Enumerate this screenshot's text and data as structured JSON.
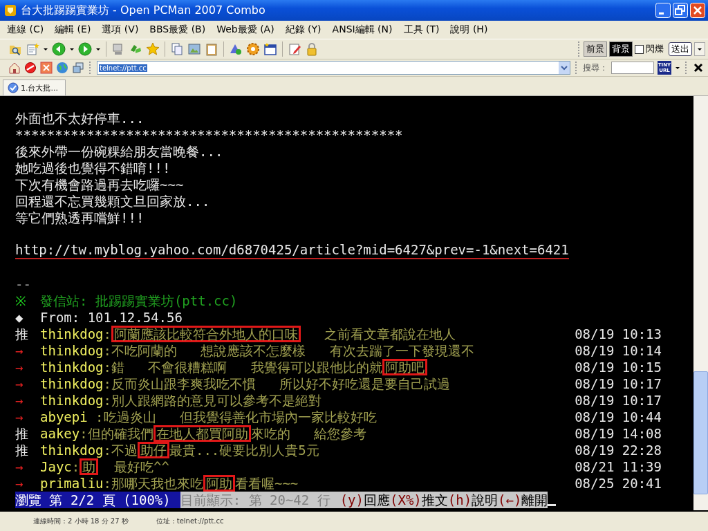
{
  "window": {
    "title": "台大批踢踢實業坊 - Open PCMan 2007 Combo"
  },
  "menu": [
    "連線 (C)",
    "編輯 (E)",
    "選項 (V)",
    "BBS最愛 (B)",
    "Web最愛 (A)",
    "紀錄 (Y)",
    "ANSI編輯 (N)",
    "工具 (T)",
    "說明 (H)"
  ],
  "toolbar": {
    "color_buttons": [
      {
        "label": "前景",
        "selected": false
      },
      {
        "label": "背景",
        "selected": true
      }
    ],
    "blink": {
      "label": "閃爍",
      "checked": false
    },
    "send": "送出"
  },
  "address_bar": {
    "value": "telnet://ptt.cc",
    "search_label": "搜尋：",
    "tinyurl": [
      "TINY",
      "URL"
    ]
  },
  "tabs": [
    {
      "label": "1.台大批...",
      "selected": true
    }
  ],
  "terminal": {
    "lines": [
      {
        "kind": "text",
        "text": "外面也不太好停車..."
      },
      {
        "kind": "text",
        "text": "*************************************************"
      },
      {
        "kind": "text",
        "text": "後來外帶一份碗粿給朋友當晚餐..."
      },
      {
        "kind": "text",
        "text": "她吃過後也覺得不錯唷!!!"
      },
      {
        "kind": "text",
        "text": "下次有機會路過再去吃囉~~~"
      },
      {
        "kind": "text",
        "text": "回程還不忘買幾顆文旦回家放..."
      },
      {
        "kind": "text",
        "text": "等它們熟透再嚐鮮!!!"
      },
      {
        "kind": "blank"
      },
      {
        "kind": "link",
        "text": "http://tw.myblog.yahoo.com/d6870425/article?mid=6427&prev=-1&next=6421"
      },
      {
        "kind": "blank"
      },
      {
        "kind": "signature",
        "text": "--"
      },
      {
        "kind": "source",
        "mark": "※",
        "text": "發信站: 批踢踢實業坊(ptt.cc)"
      },
      {
        "kind": "from",
        "mark": "◆",
        "text": "From: 101.12.54.56"
      },
      {
        "kind": "comment",
        "tag": "推",
        "user": "thinkdog",
        "segments": [
          {
            "text": ":"
          },
          {
            "text": "阿蘭應該比較符合外地人的口味",
            "boxed": true
          },
          {
            "text": "   之前看文章都說在地人"
          }
        ],
        "time": "08/19 10:13"
      },
      {
        "kind": "comment",
        "tag": "→",
        "user": "thinkdog",
        "segments": [
          {
            "text": ":不吃阿蘭的   想說應該不怎麼樣   有次去踹了一下發現還不"
          }
        ],
        "time": "08/19 10:14"
      },
      {
        "kind": "comment",
        "tag": "→",
        "user": "thinkdog",
        "segments": [
          {
            "text": ":錯   不會很糟糕啊   我覺得可以跟他比的就"
          },
          {
            "text": "阿助吧",
            "boxed": true
          }
        ],
        "time": "08/19 10:15"
      },
      {
        "kind": "comment",
        "tag": "→",
        "user": "thinkdog",
        "segments": [
          {
            "text": ":反而炎山跟李爽我吃不慣   所以好不好吃還是要自己試過"
          }
        ],
        "time": "08/19 10:17"
      },
      {
        "kind": "comment",
        "tag": "→",
        "user": "thinkdog",
        "segments": [
          {
            "text": ":別人跟網路的意見可以參考不是絕對"
          }
        ],
        "time": "08/19 10:17"
      },
      {
        "kind": "comment",
        "tag": "→",
        "user": "abyepi",
        "segments": [
          {
            "text": " :吃過炎山   但我覺得善化市場內一家比較好吃"
          }
        ],
        "time": "08/19 10:44"
      },
      {
        "kind": "comment",
        "tag": "推",
        "user": "aakey",
        "segments": [
          {
            "text": ":但的確我們"
          },
          {
            "text": "在地人都買阿助",
            "boxed": true
          },
          {
            "text": "來吃的   給您參考"
          }
        ],
        "time": "08/19 14:08"
      },
      {
        "kind": "comment",
        "tag": "推",
        "user": "thinkdog",
        "segments": [
          {
            "text": ":不過"
          },
          {
            "text": "助仔",
            "boxed": true
          },
          {
            "text": "最貴...硬要比別人貴5元"
          }
        ],
        "time": "08/19 22:28"
      },
      {
        "kind": "comment",
        "tag": "→",
        "user": "Jayc",
        "segments": [
          {
            "text": ":"
          },
          {
            "text": "助",
            "boxed": true
          },
          {
            "text": "  最好吃^^"
          }
        ],
        "time": "08/21 11:39"
      },
      {
        "kind": "comment",
        "tag": "→",
        "user": "primaliu",
        "segments": [
          {
            "text": ":那哪天我也來吃"
          },
          {
            "text": "阿助",
            "boxed": true
          },
          {
            "text": "看看喔~~~"
          }
        ],
        "time": "08/25 20:41"
      }
    ],
    "status": {
      "page": "瀏覽 第 2/2 頁 (100%)",
      "range": "目前顯示: 第 20~42 行",
      "hotkeys": [
        {
          "key": "(y)",
          "label": "回應"
        },
        {
          "key": "(X%)",
          "label": "推文"
        },
        {
          "key": "(h)",
          "label": "說明"
        },
        {
          "key": "(←)",
          "label": "離開"
        }
      ]
    }
  },
  "status_bar": {
    "connection": "連線時間：2 小時 18 分 27 秒",
    "address": "位址：telnet://ptt.cc"
  }
}
